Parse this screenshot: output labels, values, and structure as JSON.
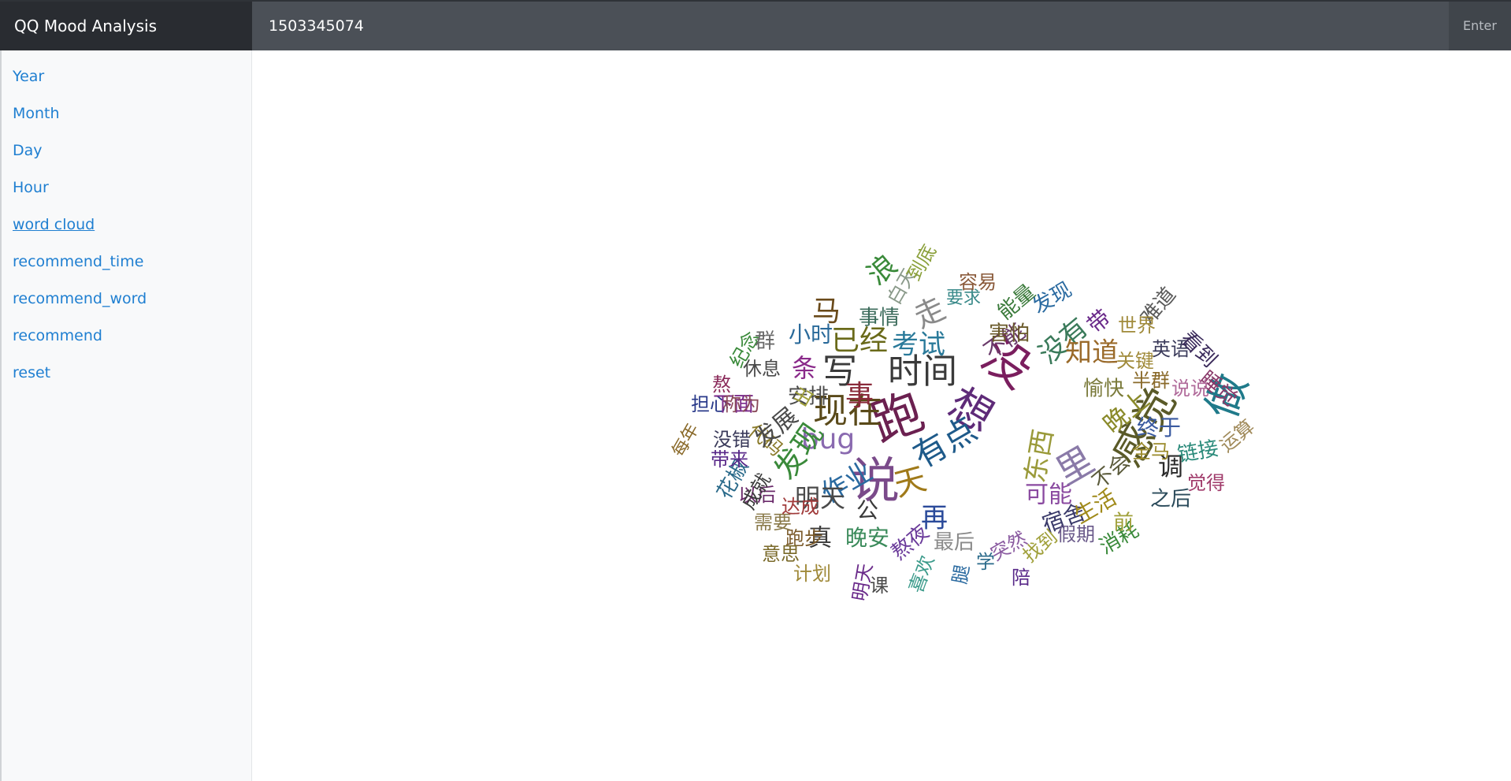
{
  "brand": "QQ Mood Analysis",
  "search": {
    "value": "1503345074"
  },
  "enter_label": "Enter",
  "sidebar": {
    "items": [
      {
        "label": "Year"
      },
      {
        "label": "Month"
      },
      {
        "label": "Day"
      },
      {
        "label": "Hour"
      },
      {
        "label": "word cloud",
        "active": true
      },
      {
        "label": "recommend_time"
      },
      {
        "label": "recommend_word"
      },
      {
        "label": "recommend"
      },
      {
        "label": "reset"
      }
    ]
  },
  "word_cloud": {
    "words": [
      {
        "text": "说",
        "color": "#7a4a8a",
        "size": 62
      },
      {
        "text": "跑",
        "color": "#6b2050",
        "size": 64
      },
      {
        "text": "没",
        "color": "#7a1e5e",
        "size": 60
      },
      {
        "text": "想",
        "color": "#5e2a78",
        "size": 54
      },
      {
        "text": "感觉",
        "color": "#5a5a28",
        "size": 52
      },
      {
        "text": "做",
        "color": "#1f7a8a",
        "size": 54
      },
      {
        "text": "时间",
        "color": "#3a3a3a",
        "size": 44
      },
      {
        "text": "写",
        "color": "#3a3a3a",
        "size": 44
      },
      {
        "text": "现在",
        "color": "#5a4a1a",
        "size": 44
      },
      {
        "text": "有点",
        "color": "#1e5a8a",
        "size": 42
      },
      {
        "text": "天",
        "color": "#a07a1a",
        "size": 40
      },
      {
        "text": "里",
        "color": "#8a7aa8",
        "size": 46
      },
      {
        "text": "bug",
        "color": "#8a6ab0",
        "size": 36
      },
      {
        "text": "发现",
        "color": "#3a8a3a",
        "size": 38
      },
      {
        "text": "作业",
        "color": "#2a6aa0",
        "size": 34
      },
      {
        "text": "已经",
        "color": "#6a6a1a",
        "size": 36
      },
      {
        "text": "考试",
        "color": "#2a7a9a",
        "size": 34
      },
      {
        "text": "没有",
        "color": "#3a7a5a",
        "size": 34
      },
      {
        "text": "知道",
        "color": "#9a6a2a",
        "size": 34
      },
      {
        "text": "东西",
        "color": "#9a9a3a",
        "size": 34
      },
      {
        "text": "明天",
        "color": "#4a4a4a",
        "size": 32
      },
      {
        "text": "再",
        "color": "#2a4a9a",
        "size": 34
      },
      {
        "text": "晚上",
        "color": "#8a8a2a",
        "size": 32
      },
      {
        "text": "调",
        "color": "#2a2a2a",
        "size": 32
      },
      {
        "text": "宿舍",
        "color": "#3a3a6a",
        "size": 28
      },
      {
        "text": "可能",
        "color": "#8a4aa0",
        "size": 30
      },
      {
        "text": "生活",
        "color": "#a08a1a",
        "size": 28
      },
      {
        "text": "马",
        "color": "#6a4a1a",
        "size": 36
      },
      {
        "text": "事情",
        "color": "#3a6a5a",
        "size": 26
      },
      {
        "text": "走",
        "color": "#8a8a8a",
        "size": 38
      },
      {
        "text": "不能",
        "color": "#6a3a6a",
        "size": 28
      },
      {
        "text": "能量",
        "color": "#3a7a3a",
        "size": 26
      },
      {
        "text": "发现",
        "color": "#2a6aa0",
        "size": 26
      },
      {
        "text": "带",
        "color": "#6a2a8a",
        "size": 28
      },
      {
        "text": "难道",
        "color": "#5a5a5a",
        "size": 26
      },
      {
        "text": "世界",
        "color": "#a08a3a",
        "size": 24
      },
      {
        "text": "英语",
        "color": "#3a3a5a",
        "size": 24
      },
      {
        "text": "看到",
        "color": "#3a2a5a",
        "size": 26
      },
      {
        "text": "睡觉",
        "color": "#8a3a6a",
        "size": 26
      },
      {
        "text": "说说",
        "color": "#b06a9a",
        "size": 24
      },
      {
        "text": "关键",
        "color": "#a08a3a",
        "size": 24
      },
      {
        "text": "愉快",
        "color": "#7a7a3a",
        "size": 26
      },
      {
        "text": "半群",
        "color": "#8a6a2a",
        "size": 24
      },
      {
        "text": "终于",
        "color": "#3a5aa0",
        "size": 28
      },
      {
        "text": "全马",
        "color": "#9a8a2a",
        "size": 24
      },
      {
        "text": "链接",
        "color": "#2a8a7a",
        "size": 26
      },
      {
        "text": "运算",
        "color": "#a08a5a",
        "size": 24
      },
      {
        "text": "觉得",
        "color": "#a03a6a",
        "size": 24
      },
      {
        "text": "之后",
        "color": "#2a4a5a",
        "size": 26
      },
      {
        "text": "消耗",
        "color": "#3a8a3a",
        "size": 26
      },
      {
        "text": "前",
        "color": "#a0a03a",
        "size": 26
      },
      {
        "text": "不会",
        "color": "#5a5a3a",
        "size": 26
      },
      {
        "text": "假期",
        "color": "#6a5a8a",
        "size": 24
      },
      {
        "text": "找到",
        "color": "#a0a03a",
        "size": 24
      },
      {
        "text": "突然",
        "color": "#8a5aa0",
        "size": 24
      },
      {
        "text": "陪",
        "color": "#5a2a8a",
        "size": 24
      },
      {
        "text": "学",
        "color": "#2a6a8a",
        "size": 24
      },
      {
        "text": "腿",
        "color": "#2a6aa0",
        "size": 24
      },
      {
        "text": "最后",
        "color": "#8a8a8a",
        "size": 26
      },
      {
        "text": "熬夜",
        "color": "#6a3a9a",
        "size": 26
      },
      {
        "text": "喜欢",
        "color": "#3a9a8a",
        "size": 24
      },
      {
        "text": "课",
        "color": "#4a4a4a",
        "size": 24
      },
      {
        "text": "明天",
        "color": "#6a2a8a",
        "size": 24
      },
      {
        "text": "计划",
        "color": "#a08a3a",
        "size": 24
      },
      {
        "text": "真",
        "color": "#3a3a3a",
        "size": 30
      },
      {
        "text": "晚安",
        "color": "#3a8a5a",
        "size": 28
      },
      {
        "text": "公",
        "color": "#3a3a3a",
        "size": 28
      },
      {
        "text": "跑步",
        "color": "#7a5a2a",
        "size": 24
      },
      {
        "text": "意思",
        "color": "#7a6a2a",
        "size": 24
      },
      {
        "text": "需要",
        "color": "#8a7a4a",
        "size": 24
      },
      {
        "text": "达成",
        "color": "#a03a3a",
        "size": 24
      },
      {
        "text": "以后",
        "color": "#6a2a6a",
        "size": 24
      },
      {
        "text": "成就",
        "color": "#3a3a3a",
        "size": 24
      },
      {
        "text": "花椒",
        "color": "#2a6a8a",
        "size": 26
      },
      {
        "text": "带来",
        "color": "#5a2a8a",
        "size": 24
      },
      {
        "text": "没错",
        "color": "#3a3a5a",
        "size": 24
      },
      {
        "text": "每年",
        "color": "#8a6a2a",
        "size": 22
      },
      {
        "text": "担心",
        "color": "#2a3a8a",
        "size": 24
      },
      {
        "text": "下面",
        "color": "#7a2a8a",
        "size": 26
      },
      {
        "text": "代码",
        "color": "#8a7a2a",
        "size": 24
      },
      {
        "text": "熬",
        "color": "#8a2a5a",
        "size": 24
      },
      {
        "text": "称为",
        "color": "#8a4a5a",
        "size": 24
      },
      {
        "text": "休息",
        "color": "#4a4a4a",
        "size": 24
      },
      {
        "text": "纪念",
        "color": "#3a8a3a",
        "size": 24
      },
      {
        "text": "群",
        "color": "#6a6a6a",
        "size": 26
      },
      {
        "text": "小时",
        "color": "#2a6a9a",
        "size": 28
      },
      {
        "text": "条",
        "color": "#8a2a8a",
        "size": 32
      },
      {
        "text": "安排",
        "color": "#4a4a4a",
        "size": 26
      },
      {
        "text": "出",
        "color": "#a0a03a",
        "size": 24
      },
      {
        "text": "发展",
        "color": "#4a4a4a",
        "size": 30
      },
      {
        "text": "浪",
        "color": "#3a8a3a",
        "size": 36
      },
      {
        "text": "白天",
        "color": "#8a9a8a",
        "size": 24
      },
      {
        "text": "到底",
        "color": "#8aa03a",
        "size": 24
      },
      {
        "text": "要求",
        "color": "#3a8a8a",
        "size": 22
      },
      {
        "text": "容易",
        "color": "#8a5a3a",
        "size": 24
      },
      {
        "text": "害怕",
        "color": "#6a5a2a",
        "size": 26
      },
      {
        "text": "事",
        "color": "#8a2a3a",
        "size": 36
      }
    ]
  }
}
